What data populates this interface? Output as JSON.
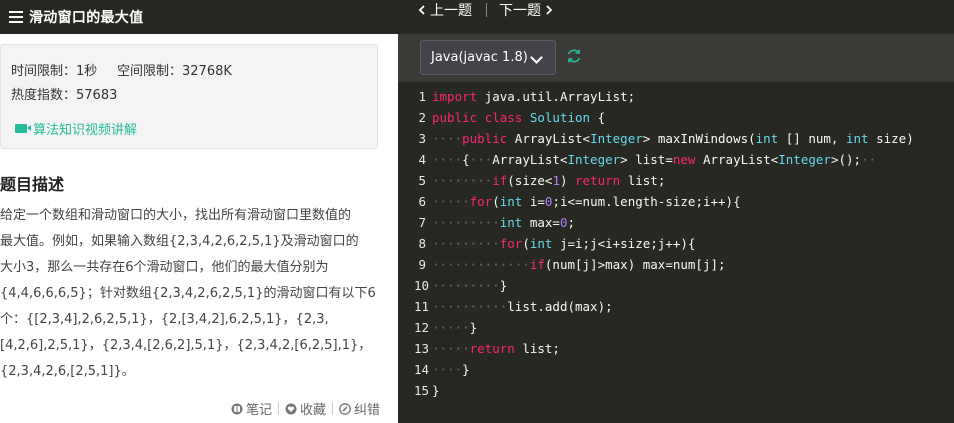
{
  "left_header": {
    "title": "滑动窗口的最大值"
  },
  "info": {
    "time_label": "时间限制：1秒",
    "space_label": "空间限制：32768K",
    "hot_label": "热度指数：57683",
    "video_link": "算法知识视频讲解"
  },
  "description": {
    "title": "题目描述",
    "lines": [
      "给定一个数组和滑动窗口的大小，找出所有滑动窗口里数值的",
      "最大值。例如，如果输入数组{2,3,4,2,6,2,5,1}及滑动窗口的",
      "大小3，那么一共存在6个滑动窗口，他们的最大值分别为",
      "{4,4,6,6,6,5}；针对数组{2,3,4,2,6,2,5,1}的滑动窗口有以下6",
      "个：{[2,3,4],2,6,2,5,1}，{2,[3,4,2],6,2,5,1}，{2,3,",
      "[4,2,6],2,5,1}，{2,3,4,[2,6,2],5,1}，{2,3,4,2,[6,2,5],1}，",
      "{2,3,4,2,6,[2,5,1]}。"
    ]
  },
  "actions": {
    "note": "笔记",
    "favorite": "收藏",
    "report": "纠错"
  },
  "nav": {
    "prev": "上一题",
    "next": "下一题"
  },
  "editor": {
    "language": "Java(javac 1.8)",
    "line_numbers": [
      "1",
      "2",
      "3",
      "4",
      "5",
      "6",
      "7",
      "8",
      "9",
      "10",
      "11",
      "12",
      "13",
      "14",
      "15"
    ],
    "lines": [
      [
        {
          "c": "k",
          "t": "import"
        },
        {
          "c": "d",
          "t": " "
        },
        {
          "c": "p",
          "t": "java.util.ArrayList;"
        }
      ],
      [
        {
          "c": "k",
          "t": "public"
        },
        {
          "c": "d",
          "t": " "
        },
        {
          "c": "k",
          "t": "class"
        },
        {
          "c": "d",
          "t": " "
        },
        {
          "c": "t",
          "t": "Solution"
        },
        {
          "c": "d",
          "t": " "
        },
        {
          "c": "p",
          "t": "{"
        }
      ],
      [
        {
          "c": "d",
          "t": "····"
        },
        {
          "c": "k",
          "t": "public"
        },
        {
          "c": "d",
          "t": " "
        },
        {
          "c": "p",
          "t": "ArrayList<"
        },
        {
          "c": "t",
          "t": "Integer"
        },
        {
          "c": "p",
          "t": ">"
        },
        {
          "c": "d",
          "t": " "
        },
        {
          "c": "p",
          "t": "maxInWindows("
        },
        {
          "c": "t",
          "t": "int"
        },
        {
          "c": "d",
          "t": " "
        },
        {
          "c": "p",
          "t": "[]"
        },
        {
          "c": "d",
          "t": " "
        },
        {
          "c": "p",
          "t": "num,"
        },
        {
          "c": "d",
          "t": " "
        },
        {
          "c": "t",
          "t": "int"
        },
        {
          "c": "d",
          "t": " "
        },
        {
          "c": "p",
          "t": "size)"
        }
      ],
      [
        {
          "c": "d",
          "t": "····"
        },
        {
          "c": "p",
          "t": "{"
        },
        {
          "c": "d",
          "t": "···"
        },
        {
          "c": "p",
          "t": "ArrayList<"
        },
        {
          "c": "t",
          "t": "Integer"
        },
        {
          "c": "p",
          "t": ">"
        },
        {
          "c": "d",
          "t": " "
        },
        {
          "c": "p",
          "t": "list="
        },
        {
          "c": "k",
          "t": "new"
        },
        {
          "c": "d",
          "t": " "
        },
        {
          "c": "p",
          "t": "ArrayList<"
        },
        {
          "c": "t",
          "t": "Integer"
        },
        {
          "c": "p",
          "t": ">();"
        },
        {
          "c": "d",
          "t": "··"
        }
      ],
      [
        {
          "c": "d",
          "t": "········"
        },
        {
          "c": "k",
          "t": "if"
        },
        {
          "c": "p",
          "t": "(size<"
        },
        {
          "c": "n",
          "t": "1"
        },
        {
          "c": "p",
          "t": ")"
        },
        {
          "c": "d",
          "t": " "
        },
        {
          "c": "k",
          "t": "return"
        },
        {
          "c": "d",
          "t": " "
        },
        {
          "c": "p",
          "t": "list;"
        }
      ],
      [
        {
          "c": "d",
          "t": "·····"
        },
        {
          "c": "k",
          "t": "for"
        },
        {
          "c": "p",
          "t": "("
        },
        {
          "c": "t",
          "t": "int"
        },
        {
          "c": "d",
          "t": " "
        },
        {
          "c": "p",
          "t": "i="
        },
        {
          "c": "n",
          "t": "0"
        },
        {
          "c": "p",
          "t": ";i<=num.length-size;i++){"
        }
      ],
      [
        {
          "c": "d",
          "t": "·········"
        },
        {
          "c": "t",
          "t": "int"
        },
        {
          "c": "d",
          "t": " "
        },
        {
          "c": "p",
          "t": "max="
        },
        {
          "c": "n",
          "t": "0"
        },
        {
          "c": "p",
          "t": ";"
        }
      ],
      [
        {
          "c": "d",
          "t": "·········"
        },
        {
          "c": "k",
          "t": "for"
        },
        {
          "c": "p",
          "t": "("
        },
        {
          "c": "t",
          "t": "int"
        },
        {
          "c": "d",
          "t": " "
        },
        {
          "c": "p",
          "t": "j=i;j<i+size;j++){"
        }
      ],
      [
        {
          "c": "d",
          "t": "·············"
        },
        {
          "c": "k",
          "t": "if"
        },
        {
          "c": "p",
          "t": "(num[j]>max)"
        },
        {
          "c": "d",
          "t": " "
        },
        {
          "c": "p",
          "t": "max=num[j];"
        }
      ],
      [
        {
          "c": "d",
          "t": "·········"
        },
        {
          "c": "p",
          "t": "}"
        }
      ],
      [
        {
          "c": "d",
          "t": "··········"
        },
        {
          "c": "p",
          "t": "list.add(max);"
        }
      ],
      [
        {
          "c": "d",
          "t": "·····"
        },
        {
          "c": "p",
          "t": "}"
        }
      ],
      [
        {
          "c": "d",
          "t": "·····"
        },
        {
          "c": "k",
          "t": "return"
        },
        {
          "c": "d",
          "t": " "
        },
        {
          "c": "p",
          "t": "list;"
        }
      ],
      [
        {
          "c": "d",
          "t": "····"
        },
        {
          "c": "p",
          "t": "}"
        }
      ],
      [
        {
          "c": "p",
          "t": "}"
        }
      ]
    ]
  },
  "colors": {
    "editor_bg": "#272822",
    "keyword": "#f92672",
    "type": "#66d9ef",
    "number": "#ae81ff",
    "accent_green": "#25bb9b"
  }
}
